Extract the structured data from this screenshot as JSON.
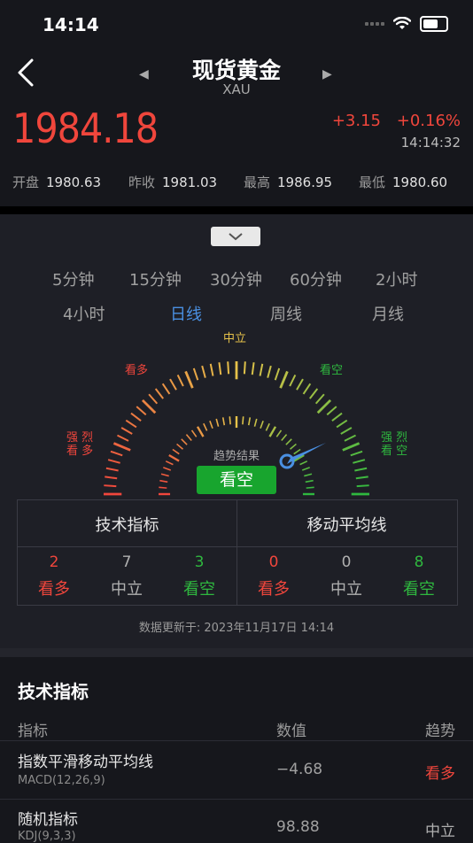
{
  "status_bar": {
    "time": "14:14"
  },
  "header": {
    "title": "现货黄金",
    "subtitle": "XAU"
  },
  "quote": {
    "price": "1984.18",
    "change": "+3.15",
    "change_pct": "+0.16%",
    "time": "14:14:32",
    "stats": [
      {
        "label": "开盘",
        "value": "1980.63"
      },
      {
        "label": "昨收",
        "value": "1981.03"
      },
      {
        "label": "最高",
        "value": "1986.95"
      },
      {
        "label": "最低",
        "value": "1980.60"
      }
    ]
  },
  "periods": {
    "row1": [
      "5分钟",
      "15分钟",
      "30分钟",
      "60分钟",
      "2小时"
    ],
    "row2": [
      "4小时",
      "日线",
      "周线",
      "月线"
    ],
    "active": "日线"
  },
  "gauge": {
    "label_neutral": "中立",
    "label_buy": "看多",
    "label_sell": "看空",
    "label_strong_buy_1": "强 烈",
    "label_strong_buy_2": "看 多",
    "label_strong_sell_1": "强 烈",
    "label_strong_sell_2": "看 空",
    "result_label": "趋势结果",
    "result": "看空",
    "colors": {
      "buy": "#f0463c",
      "neutral": "#e6c24a",
      "sell": "#2fb83f",
      "accent": "#4a90e2"
    }
  },
  "summary": {
    "tech_header": "技术指标",
    "ma_header": "移动平均线",
    "tech": [
      {
        "count": "2",
        "label": "看多"
      },
      {
        "count": "7",
        "label": "中立"
      },
      {
        "count": "3",
        "label": "看空"
      }
    ],
    "ma": [
      {
        "count": "0",
        "label": "看多"
      },
      {
        "count": "0",
        "label": "中立"
      },
      {
        "count": "8",
        "label": "看空"
      }
    ]
  },
  "update_text": "数据更新于: 2023年11月17日 14:14",
  "indicators": {
    "title": "技术指标",
    "col_name": "指标",
    "col_value": "数值",
    "col_trend": "趋势",
    "rows": [
      {
        "name": "指数平滑移动平均线",
        "sub": "MACD(12,26,9)",
        "value": "−4.68",
        "trend": "看多"
      },
      {
        "name": "随机指标",
        "sub": "KDJ(9,3,3)",
        "value": "98.88",
        "trend": "中立"
      }
    ]
  }
}
